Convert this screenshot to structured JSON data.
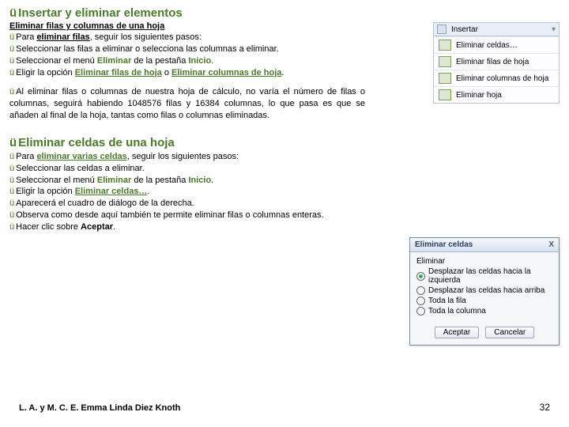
{
  "title1": "Insertar y eliminar elementos",
  "subtitle": "Eliminar filas y columnas de una hoja",
  "p1_a": "Para ",
  "p1_b": "eliminar filas",
  "p1_c": ", seguir los siguientes pasos:",
  "p2": "Seleccionar las filas a eliminar o selecciona las columnas a eliminar.",
  "p3_a": "Seleccionar el menú ",
  "p3_b": "Eliminar",
  "p3_c": " de la pestaña ",
  "p3_d": "Inicio",
  "p3_e": ".",
  "p4_a": "Eligir la opción ",
  "p4_b": "Eliminar filas de hoja",
  "p4_c": " o ",
  "p4_d": "Eliminar columnas de hoja",
  "p4_e": ".",
  "para2": "Al eliminar filas o columnas de nuestra hoja de cálculo, no varía el número de filas o columnas, seguirá habiendo 1048576 filas y 16384 columnas, lo que pasa es que se añaden al final de la hoja, tantas como filas o columnas eliminadas.",
  "title2": "Eliminar celdas de una hoja",
  "q1_a": "Para ",
  "q1_b": "eliminar varias celdas",
  "q1_c": ", seguir los siguientes pasos:",
  "q2": "Seleccionar las celdas a eliminar.",
  "q3_a": "Seleccionar el menú ",
  "q3_b": "Eliminar",
  "q3_c": " de la pestaña ",
  "q3_d": "Inicio",
  "q3_e": ".",
  "q4_a": "Eligir la opción ",
  "q4_b": "Eliminar celdas…",
  "q4_c": ".",
  "q5": "Aparecerá el cuadro de diálogo de la derecha.",
  "q6": "Observa como desde aquí también te permite eliminar filas o columnas enteras.",
  "q7_a": "Hacer clic sobre ",
  "q7_b": "Aceptar",
  "q7_c": ".",
  "footer_left": "L. A. y M. C. E. Emma Linda Diez Knoth",
  "page_num": "32",
  "menu": {
    "insertar": "Insertar",
    "item1": "Eliminar celdas…",
    "item2": "Eliminar filas de hoja",
    "item3": "Eliminar columnas de hoja",
    "item4": "Eliminar hoja"
  },
  "dialog": {
    "title": "Eliminar celdas",
    "close": "X",
    "group": "Eliminar",
    "opt1": "Desplazar las celdas hacia la izquierda",
    "opt2": "Desplazar las celdas hacia arriba",
    "opt3": "Toda la fila",
    "opt4": "Toda la columna",
    "ok": "Aceptar",
    "cancel": "Cancelar"
  }
}
